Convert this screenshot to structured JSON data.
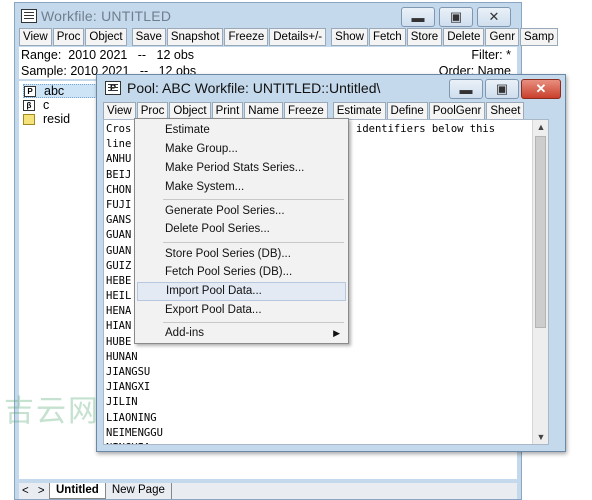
{
  "workfile": {
    "title": "Workfile: UNTITLED",
    "toolbar": [
      "View",
      "Proc",
      "Object",
      "Save",
      "Snapshot",
      "Freeze",
      "Details+/-",
      "Show",
      "Fetch",
      "Store",
      "Delete",
      "Genr",
      "Samp"
    ],
    "range_line": "Range:  2010 2021   --   12 obs",
    "sample_line": "Sample: 2010 2021   --   12 obs",
    "filter": "Filter: *",
    "order": "Order: Name",
    "objects": [
      {
        "icon": "P",
        "name": "abc"
      },
      {
        "icon": "β",
        "name": "c"
      },
      {
        "icon": "",
        "name": "resid"
      }
    ],
    "tabs": {
      "active": "Untitled",
      "new": "New Page",
      "arrows": "< >"
    }
  },
  "pool": {
    "icon_label": "P",
    "title": "Pool: ABC   Workfile: UNTITLED::Untitled\\",
    "toolbar": [
      "View",
      "Proc",
      "Object",
      "Print",
      "Name",
      "Freeze",
      "Estimate",
      "Define",
      "PoolGenr",
      "Sheet"
    ],
    "prompt_tail": "identifiers below this",
    "lines": [
      "Cros",
      "line",
      "ANHU",
      "BEIJ",
      "CHON",
      "FUJI",
      "GANS",
      "GUAN",
      "GUAN",
      "GUIZ",
      "HEBE",
      "HEIL",
      "HENA",
      "HIAN",
      "HUBE",
      "HUNAN",
      "JIANGSU",
      "JIANGXI",
      "JILIN",
      "LIAONING",
      "NEIMENGGU",
      "NINGXIA"
    ]
  },
  "menu": {
    "items": [
      {
        "label": "Estimate"
      },
      {
        "label": "Make Group..."
      },
      {
        "label": "Make Period Stats Series..."
      },
      {
        "label": "Make System..."
      },
      {
        "label": "Generate Pool Series..."
      },
      {
        "label": "Delete Pool Series..."
      },
      {
        "label": "Store Pool Series (DB)..."
      },
      {
        "label": "Fetch Pool Series (DB)..."
      },
      {
        "label": "Import Pool Data...",
        "highlighted": true
      },
      {
        "label": "Export Pool Data..."
      },
      {
        "label": "Add-ins",
        "submenu": true
      }
    ]
  },
  "watermark": "吉云网"
}
